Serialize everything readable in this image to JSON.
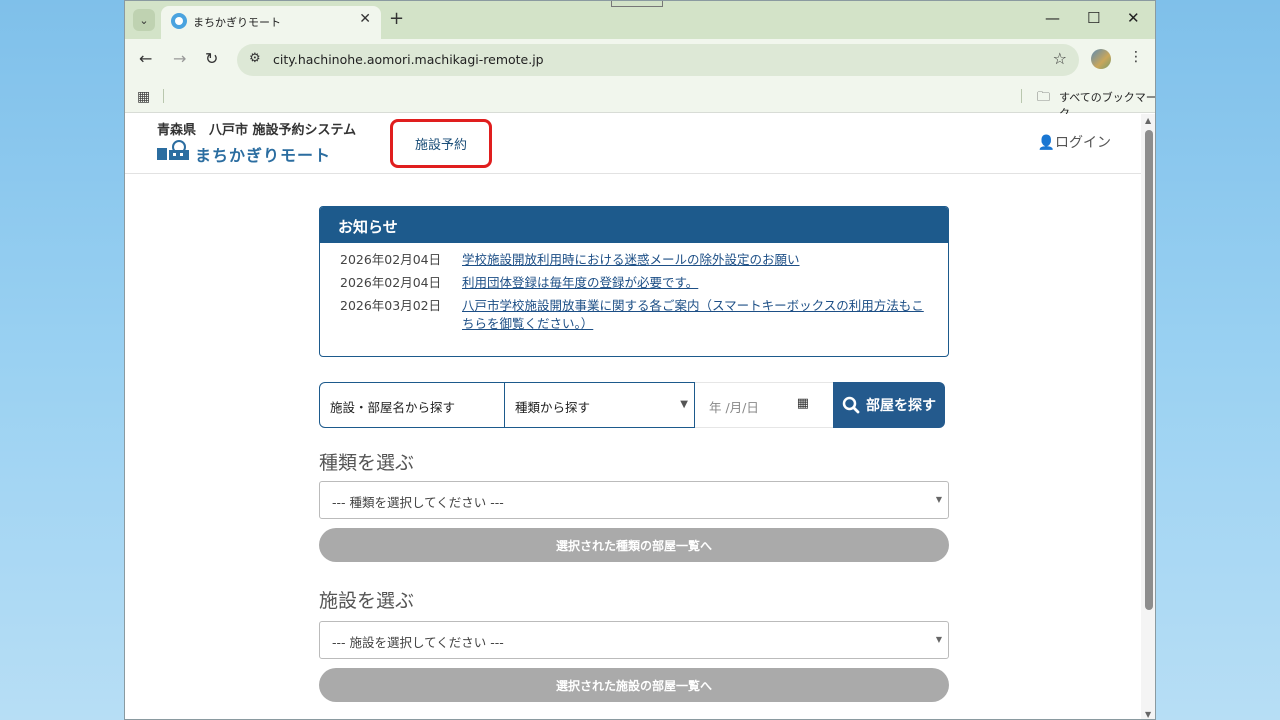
{
  "browser": {
    "tab_title": "まちかぎりモート",
    "new_tab": "+",
    "close_tab": "✕",
    "url": "city.hachinohe.aomori.machikagi-remote.jp",
    "bookmarks_label": "すべてのブックマーク"
  },
  "site": {
    "subtitle": "青森県　八戸市 施設予約システム",
    "logo_text": "まちかぎりモート",
    "nav_facility": "施設予約",
    "login": "👤ログイン"
  },
  "notice": {
    "heading": "お知らせ",
    "items": [
      {
        "date": "2026年02月04日",
        "text": "学校施設開放利用時における迷惑メールの除外設定のお願い"
      },
      {
        "date": "2026年02月04日",
        "text": "利用団体登録は毎年度の登録が必要です。"
      },
      {
        "date": "2026年03月02日",
        "text": "八戸市学校施設開放事業に関する各ご案内（スマートキーボックスの利用方法もこちらを御覧ください。）"
      }
    ]
  },
  "search": {
    "facility_placeholder": "施設・部屋名から探す",
    "type_select": "種類から探す",
    "date_placeholder": "年 /月/日",
    "button": "部屋を探す"
  },
  "type_section": {
    "title": "種類を選ぶ",
    "select": "--- 種類を選択してください ---",
    "button": "選択された種類の部屋一覧へ"
  },
  "facility_section": {
    "title": "施設を選ぶ",
    "select": "--- 施設を選択してください ---",
    "button": "選択された施設の部屋一覧へ"
  }
}
